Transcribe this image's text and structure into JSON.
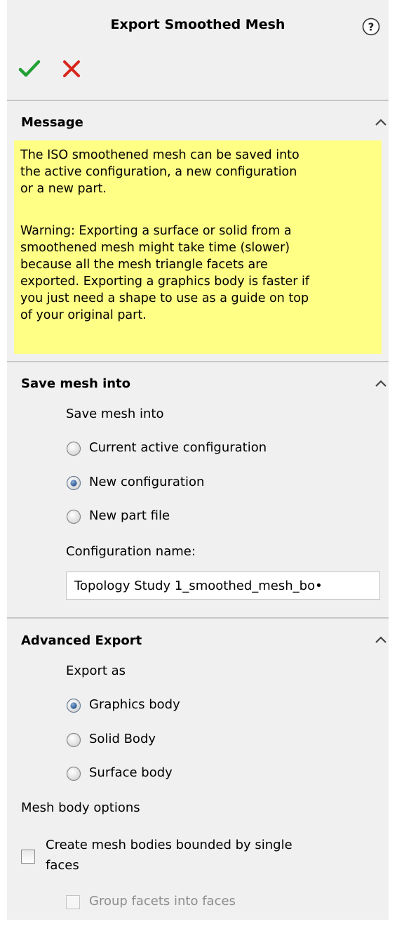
{
  "header": {
    "title": "Export Smoothed Mesh",
    "help_icon": "question-mark-circle-icon",
    "ok_icon": "green-checkmark-icon",
    "cancel_icon": "red-x-icon"
  },
  "colors": {
    "panel_background": "#f0f0f0",
    "message_background": "#ffff86",
    "ok_green": "#22a035",
    "cancel_red": "#d8261c"
  },
  "message": {
    "title": "Message",
    "paragraph1": "The ISO smoothened mesh can be saved into\nthe active configuration, a new configuration\nor a new part.",
    "paragraph2": "Warning: Exporting a surface or solid from a\nsmoothened mesh might take time (slower)\nbecause all the mesh triangle facets are\nexported. Exporting a graphics body is faster if\nyou just need a shape to use as a guide on top\nof your original part."
  },
  "save_mesh": {
    "title": "Save mesh into",
    "group_label": "Save mesh into",
    "options": [
      {
        "label": "Current active configuration",
        "selected": false
      },
      {
        "label": "New configuration",
        "selected": true
      },
      {
        "label": "New part file",
        "selected": false
      }
    ],
    "config_name_label": "Configuration name:",
    "config_name_value": "Topology Study 1_smoothed_mesh_bo•"
  },
  "advanced_export": {
    "title": "Advanced Export",
    "export_as_label": "Export as",
    "options": [
      {
        "label": "Graphics body",
        "selected": true
      },
      {
        "label": "Solid Body",
        "selected": false
      },
      {
        "label": "Surface body",
        "selected": false
      }
    ],
    "mesh_options_label": "Mesh body options",
    "create_mesh_bodies_label_line1": "Create mesh bodies bounded by single",
    "create_mesh_bodies_label_line2": "faces",
    "create_mesh_bodies_checked": false,
    "group_facets_label": "Group facets into faces",
    "group_facets_checked": false,
    "group_facets_enabled": false
  }
}
